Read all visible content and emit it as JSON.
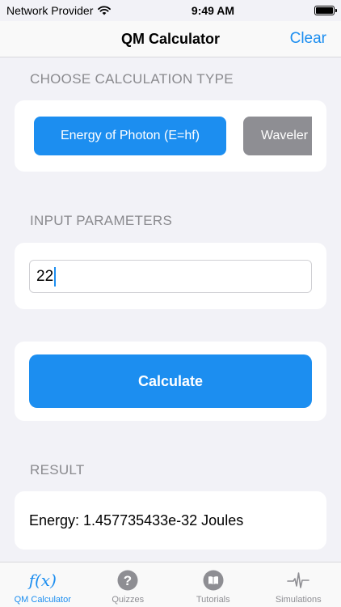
{
  "status_bar": {
    "carrier": "Network Provider",
    "time": "9:49 AM"
  },
  "nav": {
    "title": "QM Calculator",
    "clear_label": "Clear"
  },
  "calc_type": {
    "header": "CHOOSE CALCULATION TYPE",
    "options": [
      "Energy of Photon (E=hf)",
      "Waveler"
    ],
    "selected": "Energy of Photon (E=hf)"
  },
  "input": {
    "header": "INPUT PARAMETERS",
    "value": "22"
  },
  "calculate_label": "Calculate",
  "result": {
    "header": "RESULT",
    "text": "Energy: 1.457735433e-32 Joules"
  },
  "tabs": [
    {
      "label": "QM Calculator",
      "icon": "fx-icon"
    },
    {
      "label": "Quizzes",
      "icon": "question-circle-icon"
    },
    {
      "label": "Tutorials",
      "icon": "book-icon"
    },
    {
      "label": "Simulations",
      "icon": "waveform-icon"
    }
  ],
  "colors": {
    "accent": "#1c8ef0",
    "inactive_button": "#8e8e93",
    "background": "#f2f2f7"
  }
}
